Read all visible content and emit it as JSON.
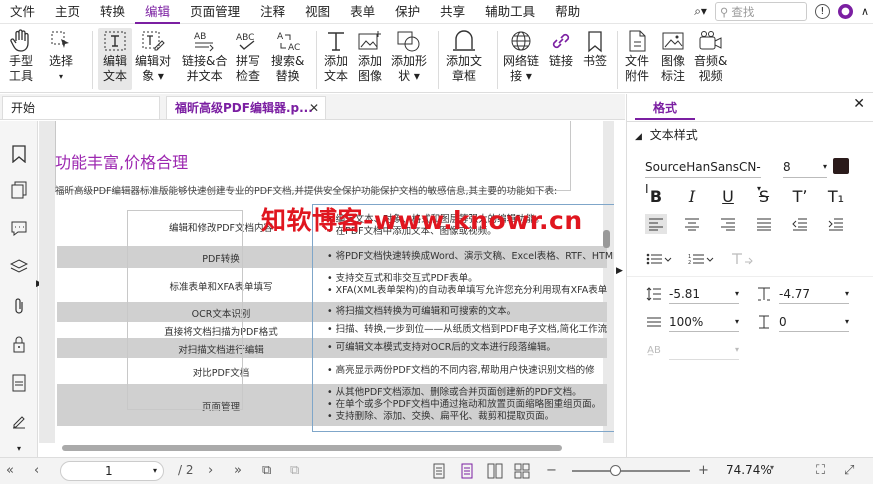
{
  "menu": {
    "items": [
      "文件",
      "主页",
      "转换",
      "编辑",
      "页面管理",
      "注释",
      "视图",
      "表单",
      "保护",
      "共享",
      "辅助工具",
      "帮助"
    ],
    "active_index": 3,
    "search_placeholder": "查找"
  },
  "ribbon": {
    "hand_tool": [
      "手型",
      "工具"
    ],
    "select": [
      "选择",
      "▾"
    ],
    "edit_text": [
      "编辑",
      "文本"
    ],
    "edit_object": [
      "编辑对",
      "象 ▾"
    ],
    "link_merge": [
      "链接&合",
      "并文本"
    ],
    "spell_check": [
      "拼写",
      "检查"
    ],
    "search_replace": [
      "搜索&",
      "替换"
    ],
    "add_text": [
      "添加",
      "文本"
    ],
    "add_image": [
      "添加",
      "图像"
    ],
    "add_shape": [
      "添加形",
      "状 ▾"
    ],
    "add_text_seal": [
      "添加文",
      "章框"
    ],
    "web_link": [
      "网络链",
      "接 ▾"
    ],
    "link": [
      "链接"
    ],
    "bookmark": [
      "书签"
    ],
    "file_attach": [
      "文件",
      "附件"
    ],
    "image_annot": [
      "图像",
      "标注"
    ],
    "audio_video": [
      "音频&",
      "视频"
    ]
  },
  "tabs": {
    "start": "开始",
    "doc": "福昕高级PDF编辑器.p..."
  },
  "document": {
    "title": "功能丰富,价格合理",
    "para": "福昕高级PDF编辑器标准版能够快速创建专业的PDF文档,并提供安全保护功能保护文档的敏感信息,其主要的功能如下表:",
    "rows": [
      {
        "name": "编辑和修改PDF文档内容",
        "desc": [
          "编辑文本、对象、格式和图层等强大的编辑功能。",
          "在PDF文档中添加文本、图像或视频。"
        ],
        "gray": false
      },
      {
        "name": "PDF转换",
        "desc": [
          "将PDF文档快速转换成Word、演示文稿、Excel表格、RTF、HTML"
        ],
        "gray": true
      },
      {
        "name": "标准表单和XFA表单填写",
        "desc": [
          "支持交互式和非交互式PDF表单。",
          "XFA(XML表单架构)的自动表单填写允许您充分利用现有XFA表单"
        ],
        "gray": false
      },
      {
        "name": "OCR文本识别",
        "desc": [
          "将扫描文档转换为可编辑和可搜索的文本。"
        ],
        "gray": true
      },
      {
        "name": "直接将文档扫描为PDF格式",
        "desc": [
          "扫描、转换,一步到位——从纸质文档到PDF电子文档,简化工作流"
        ],
        "gray": false
      },
      {
        "name": "对扫描文档进行编辑",
        "desc": [
          "可编辑文本模式支持对OCR后的文本进行段落编辑。"
        ],
        "gray": true
      },
      {
        "name": "对比PDF文档",
        "desc": [
          "高亮显示两份PDF文档的不同内容,帮助用户快速识别文档的修"
        ],
        "gray": false
      },
      {
        "name": "页面管理",
        "desc": [
          "从其他PDF文档添加、删除或合并页面创建新的PDF文档。",
          "在单个或多个PDF文档中通过拖动和放置页面缩略图重组页面。",
          "支持删除、添加、交换、扁平化、裁剪和提取页面。"
        ],
        "gray": true
      }
    ],
    "watermark": "知软博客-www.knowr.cn"
  },
  "panel": {
    "tab": "格式",
    "section": "文本样式",
    "font": "SourceHanSansCN-I",
    "size": "8",
    "color": "#2b1b1b",
    "line_spacing": "-5.81",
    "char_spacing": "-4.77",
    "scale": "100%",
    "baseline": "0"
  },
  "status": {
    "page": "1",
    "total": "/ 2",
    "zoom": "74.74%"
  }
}
